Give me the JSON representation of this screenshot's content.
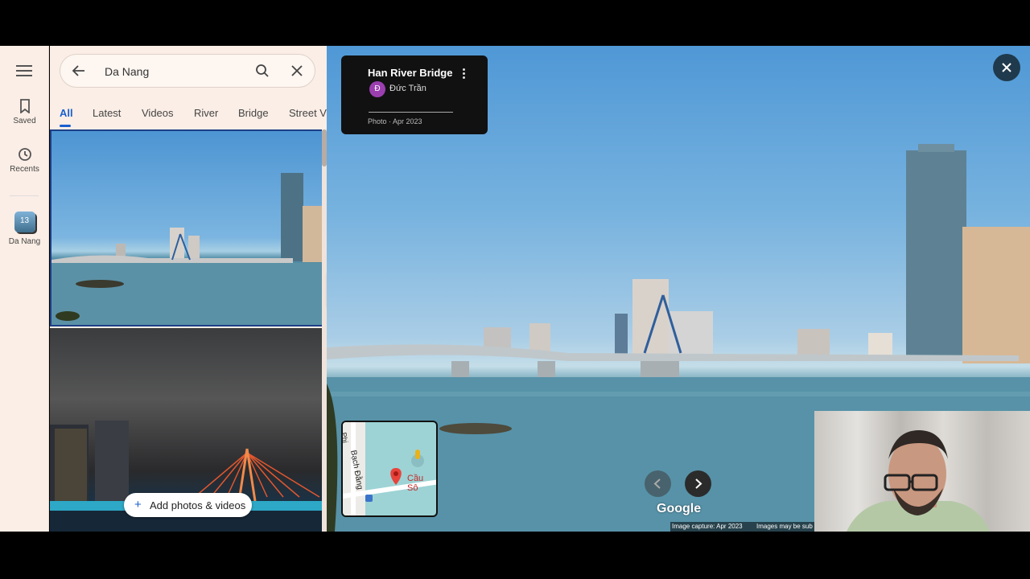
{
  "rail": {
    "saved_label": "Saved",
    "recents_label": "Recents",
    "collection_count": "13",
    "collection_label": "Da Nang"
  },
  "search": {
    "query": "Da Nang"
  },
  "tabs": [
    "All",
    "Latest",
    "Videos",
    "River",
    "Bridge",
    "Street Vi"
  ],
  "add_photos_label": "Add photos & videos",
  "photo_card": {
    "title": "Han River Bridge",
    "author_initial": "Đ",
    "author": "Đức Trần",
    "meta": "Photo · Apr 2023"
  },
  "minimap": {
    "street": "Bạch Đằng",
    "place": "Cầu Sô",
    "street2": "Phi"
  },
  "viewer": {
    "logo": "Google",
    "capture": "Image capture: Apr 2023",
    "notice": "Images may be sub"
  },
  "colors": {
    "accent": "#1a5fd0",
    "panel_bg": "#fbeee6",
    "card_bg": "#111111",
    "pin": "#e8423a"
  }
}
